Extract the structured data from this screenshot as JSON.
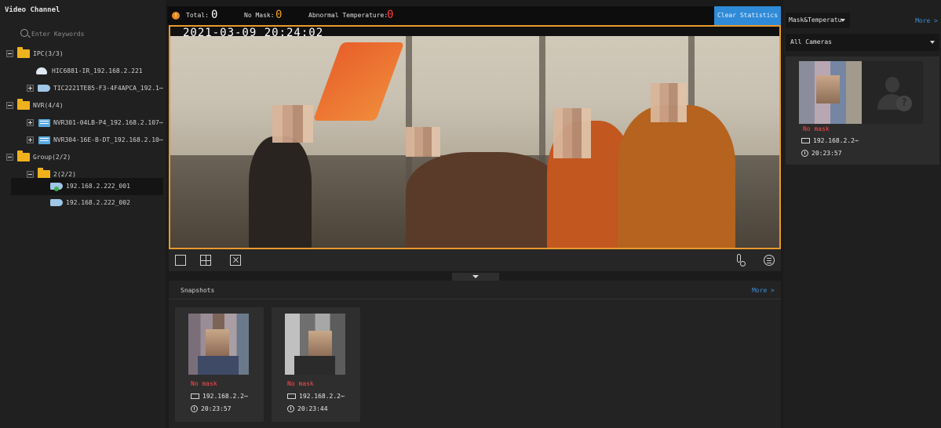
{
  "left_panel": {
    "title": "Video Channel",
    "search_placeholder": "Enter Keywords",
    "tree": [
      {
        "label": "IPC(3/3)",
        "type": "folder"
      },
      {
        "label": "HIC6881-IR_192.168.2.221",
        "type": "dome-camera"
      },
      {
        "label": "TIC2221TE85-F3-4F4APCA_192.1⋯",
        "type": "bullet-camera"
      },
      {
        "label": "NVR(4/4)",
        "type": "folder"
      },
      {
        "label": "NVR301-04LB-P4_192.168.2.107⋯",
        "type": "nvr"
      },
      {
        "label": "NVR304-16E-B-DT_192.168.2.10⋯",
        "type": "nvr"
      },
      {
        "label": "Group(2/2)",
        "type": "folder"
      },
      {
        "label": "2(2/2)",
        "type": "folder"
      },
      {
        "label": "192.168.2.222_001",
        "type": "bullet-camera",
        "selected": true
      },
      {
        "label": "192.168.2.222_002",
        "type": "bullet-camera"
      }
    ]
  },
  "stats": {
    "total_label": "Total:",
    "total_value": "0",
    "no_mask_label": "No Mask:",
    "no_mask_value": "0",
    "abnormal_label": "Abnormal Temperature:",
    "abnormal_value": "0",
    "clear_button": "Clear Statistics",
    "colors": {
      "total": "#ffffff",
      "no_mask": "#f0a020",
      "abnormal": "#ff3b3b",
      "accent": "#2f8ad8"
    }
  },
  "video": {
    "timestamp": "2021-03-09 20:24:02"
  },
  "snapshots": {
    "title": "Snapshots",
    "more": "More >",
    "cards": [
      {
        "status": "No mask",
        "ip": "192.168.2.2⋯",
        "time": "20:23:57"
      },
      {
        "status": "No mask",
        "ip": "192.168.2.2⋯",
        "time": "20:23:44"
      }
    ]
  },
  "right_panel": {
    "filter_label": "Mask&Temperatu",
    "more": "More >",
    "camera_filter": "All Cameras",
    "card": {
      "status": "No mask",
      "ip": "192.168.2.2⋯",
      "time": "20:23:57"
    }
  }
}
